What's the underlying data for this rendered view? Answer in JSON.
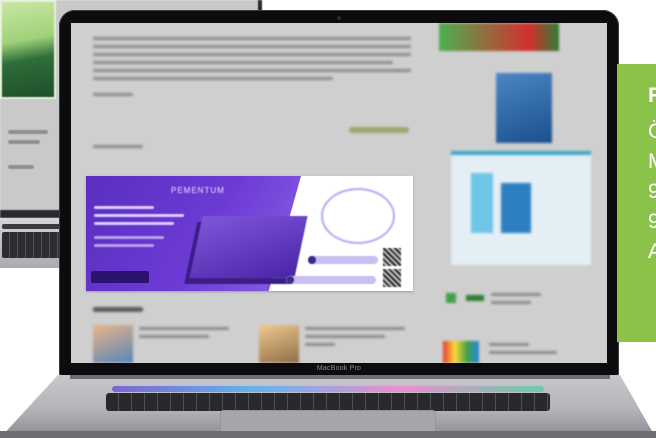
{
  "device": {
    "model_label": "MacBook Pro"
  },
  "callout": {
    "heading": "F",
    "lines": [
      "Ö",
      "M",
      "9",
      "9",
      "A"
    ],
    "color": "#8bc34a"
  },
  "ad_banner": {
    "primary_color": "#6c3bd5"
  }
}
